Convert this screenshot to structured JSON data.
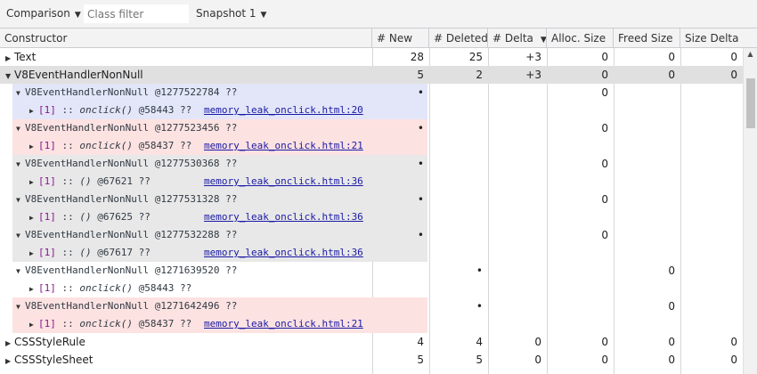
{
  "toolbar": {
    "view_label": "Comparison",
    "filter_placeholder": "Class filter",
    "snapshot_label": "Snapshot 1"
  },
  "columns": [
    "Constructor",
    "# New",
    "# Deleted",
    "# Delta",
    "Alloc. Size",
    "Freed Size",
    "Size Delta"
  ],
  "rows": [
    {
      "kind": "class",
      "expanded": false,
      "selected": false,
      "name": "Text",
      "new": "28",
      "deleted": "25",
      "delta": "+3",
      "alloc": "0",
      "freed": "0",
      "size_delta": "0"
    },
    {
      "kind": "class",
      "expanded": true,
      "selected": true,
      "name": "V8EventHandlerNonNull",
      "new": "5",
      "deleted": "2",
      "delta": "+3",
      "alloc": "0",
      "freed": "0",
      "size_delta": "0"
    },
    {
      "kind": "instance",
      "bg": "blue",
      "name": "V8EventHandlerNonNull @1277522784 ??",
      "dot_col": "new",
      "size_col": "alloc",
      "size": "0"
    },
    {
      "kind": "ret",
      "bg": "blue",
      "idx": "[1]",
      "sep": " :: ",
      "fn": "onclick()",
      "id": " @58443 ??",
      "link": "memory_leak_onclick.html:20"
    },
    {
      "kind": "instance",
      "bg": "pink",
      "name": "V8EventHandlerNonNull @1277523456 ??",
      "dot_col": "new",
      "size_col": "alloc",
      "size": "0"
    },
    {
      "kind": "ret",
      "bg": "pink",
      "idx": "[1]",
      "sep": " :: ",
      "fn": "onclick()",
      "id": " @58437 ??",
      "link": "memory_leak_onclick.html:21"
    },
    {
      "kind": "instance",
      "bg": "grey",
      "name": "V8EventHandlerNonNull @1277530368 ??",
      "dot_col": "new",
      "size_col": "alloc",
      "size": "0"
    },
    {
      "kind": "ret",
      "bg": "grey",
      "idx": "[1]",
      "sep": " :: ",
      "fn": "()",
      "id": " @67621 ??",
      "link": "memory_leak_onclick.html:36"
    },
    {
      "kind": "instance",
      "bg": "grey",
      "name": "V8EventHandlerNonNull @1277531328 ??",
      "dot_col": "new",
      "size_col": "alloc",
      "size": "0"
    },
    {
      "kind": "ret",
      "bg": "grey",
      "idx": "[1]",
      "sep": " :: ",
      "fn": "()",
      "id": " @67625 ??",
      "link": "memory_leak_onclick.html:36"
    },
    {
      "kind": "instance",
      "bg": "grey",
      "name": "V8EventHandlerNonNull @1277532288 ??",
      "dot_col": "new",
      "size_col": "alloc",
      "size": "0"
    },
    {
      "kind": "ret",
      "bg": "grey",
      "idx": "[1]",
      "sep": " :: ",
      "fn": "()",
      "id": " @67617 ??",
      "link": "memory_leak_onclick.html:36"
    },
    {
      "kind": "instance",
      "bg": "none",
      "name": "V8EventHandlerNonNull @1271639520 ??",
      "dot_col": "deleted",
      "size_col": "freed",
      "size": "0"
    },
    {
      "kind": "ret",
      "bg": "none",
      "idx": "[1]",
      "sep": " :: ",
      "fn": "onclick()",
      "id": " @58443 ??",
      "link": ""
    },
    {
      "kind": "instance",
      "bg": "pink",
      "name": "V8EventHandlerNonNull @1271642496 ??",
      "dot_col": "deleted",
      "size_col": "freed",
      "size": "0"
    },
    {
      "kind": "ret",
      "bg": "pink",
      "idx": "[1]",
      "sep": " :: ",
      "fn": "onclick()",
      "id": " @58437 ??",
      "link": "memory_leak_onclick.html:21"
    },
    {
      "kind": "class",
      "expanded": false,
      "selected": false,
      "name": "CSSStyleRule",
      "new": "4",
      "deleted": "4",
      "delta": "0",
      "alloc": "0",
      "freed": "0",
      "size_delta": "0"
    },
    {
      "kind": "class",
      "expanded": false,
      "selected": false,
      "name": "CSSStyleSheet",
      "new": "5",
      "deleted": "5",
      "delta": "0",
      "alloc": "0",
      "freed": "0",
      "size_delta": "0"
    }
  ],
  "icons": {
    "dropdown": "▼",
    "collapsed": "▶",
    "expanded": "▼",
    "sort_desc": "▼",
    "scroll_up": "▲",
    "dot": "•"
  },
  "colors": {
    "blue_highlight": "#e3e6f8",
    "pink_highlight": "#fde2e2",
    "grey_highlight": "#e8e8e8",
    "selected_row": "#e0e0e0",
    "link": "#1a1aa6"
  }
}
